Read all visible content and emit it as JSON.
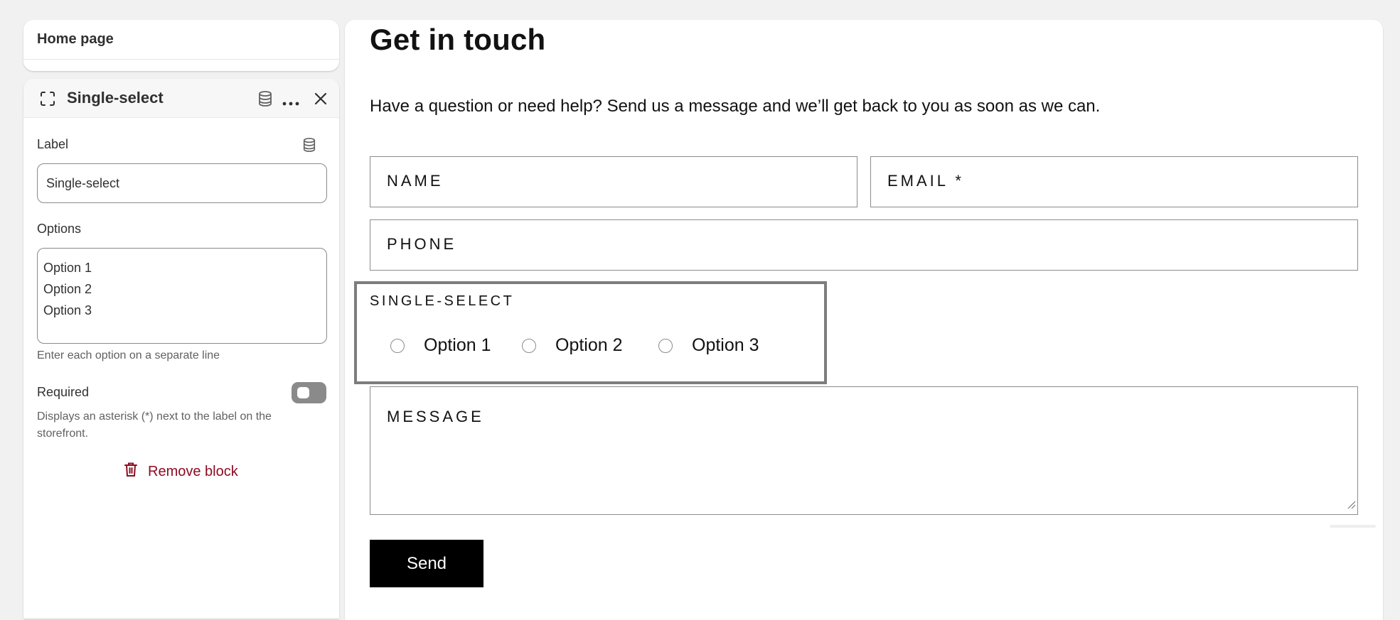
{
  "breadcrumb": {
    "title": "Home page"
  },
  "block_editor": {
    "title": "Single-select",
    "label_field": {
      "label": "Label",
      "value": "Single-select"
    },
    "options_field": {
      "label": "Options",
      "lines": [
        "Option 1",
        "Option 2",
        "Option 3"
      ],
      "help": "Enter each option on a separate line"
    },
    "required": {
      "label": "Required",
      "enabled": false,
      "help": "Displays an asterisk (*) next to the label on the storefront."
    },
    "remove_label": "Remove block"
  },
  "preview": {
    "title": "Get in touch",
    "description": "Have a question or need help? Send us a message and we’ll get back to you as soon as we can.",
    "fields": {
      "name": "NAME",
      "email": "EMAIL *",
      "phone": "PHONE",
      "message": "MESSAGE"
    },
    "single_select": {
      "label": "SINGLE-SELECT",
      "options": [
        "Option 1",
        "Option 2",
        "Option 3"
      ]
    },
    "send_label": "Send"
  },
  "colors": {
    "danger": "#8e0b21",
    "preview_text": "#121212",
    "button_bg": "#000000",
    "selected_outline": "#7d7d7d"
  }
}
